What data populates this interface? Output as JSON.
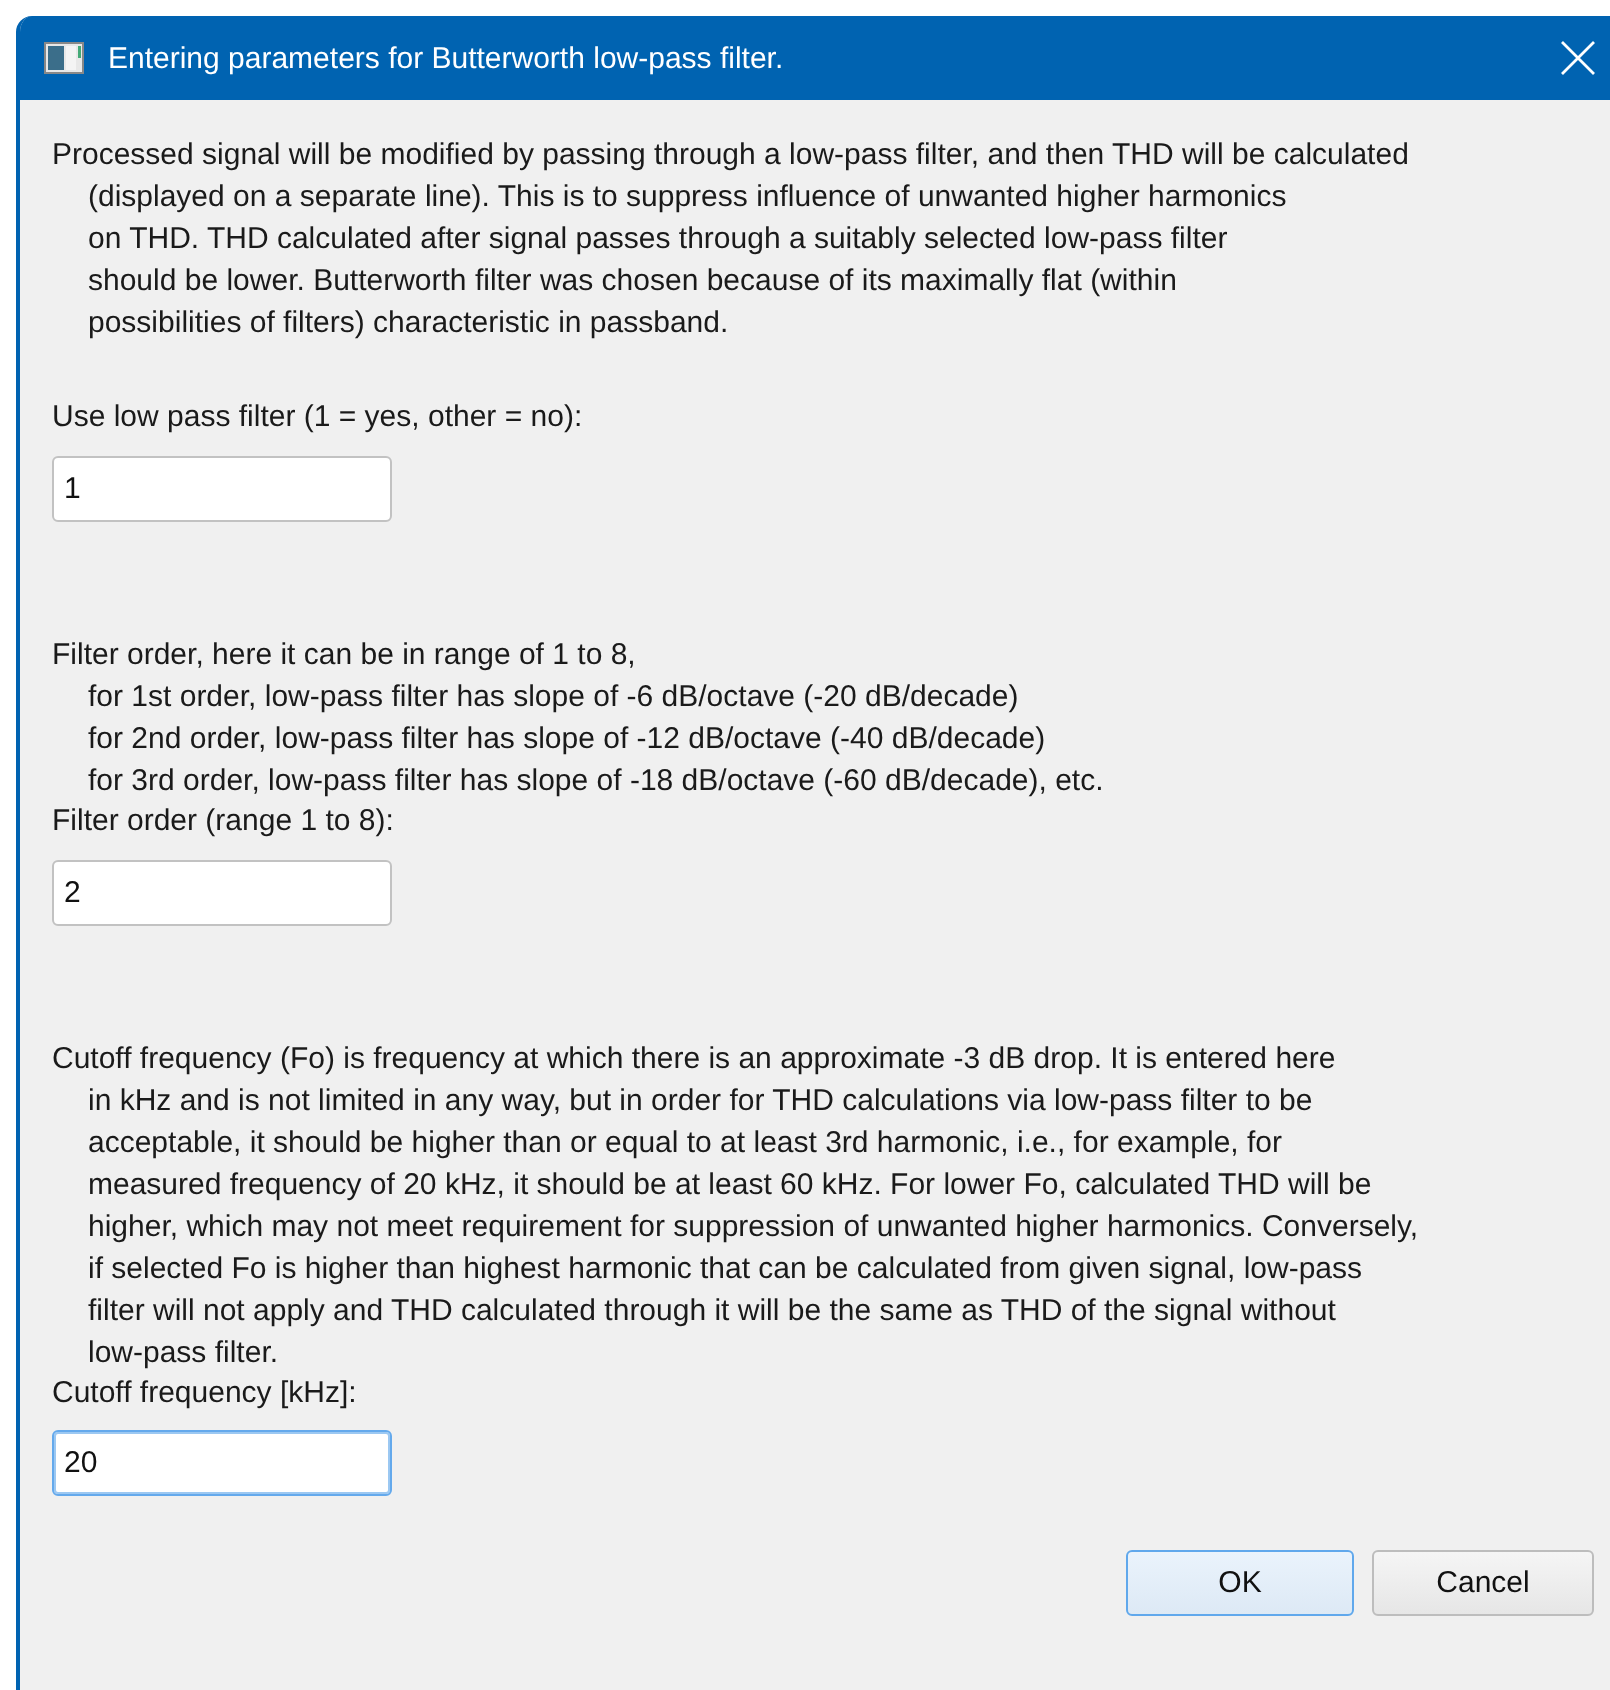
{
  "window": {
    "title": "Entering parameters for Butterworth low-pass filter."
  },
  "sections": [
    {
      "description": [
        "Processed signal will be modified by passing through a low-pass filter, and then THD will be calculated",
        "(displayed on a separate line). This is to suppress influence of unwanted higher harmonics",
        "on THD. THD calculated after signal passes through a suitably selected low-pass filter",
        "should be lower. Butterworth filter was chosen because of its maximally flat (within",
        "possibilities of filters) characteristic in passband."
      ],
      "label": "Use low pass filter (1 = yes, other = no):",
      "field": {
        "value": "1",
        "focused": false
      }
    },
    {
      "description": [
        "Filter order, here it can be in range of 1 to 8,",
        "for 1st order, low-pass filter has slope of -6 dB/octave (-20 dB/decade)",
        "for 2nd order, low-pass filter has slope of -12 dB/octave (-40 dB/decade)",
        "for 3rd order, low-pass filter has slope of -18 dB/octave (-60 dB/decade), etc."
      ],
      "label": "Filter order (range 1 to 8):",
      "field": {
        "value": "2",
        "focused": false
      }
    },
    {
      "description": [
        "Cutoff frequency (Fo) is frequency at which there is an approximate -3 dB drop. It is entered here",
        "in kHz and is not limited in any way, but in order for THD calculations via low-pass filter to be",
        "acceptable, it should be higher than or equal to at least 3rd harmonic, i.e., for example, for",
        "measured frequency of 20 kHz, it should be at least 60 kHz. For lower Fo, calculated THD will be",
        "higher, which may not meet requirement for suppression of unwanted higher harmonics. Conversely,",
        "if selected Fo is higher than highest harmonic that can be calculated from given signal, low-pass",
        "filter will not apply and THD calculated through it will be the same as THD of the signal without",
        "low-pass filter."
      ],
      "label": "Cutoff frequency [kHz]:",
      "field": {
        "value": "20",
        "focused": true
      }
    }
  ],
  "buttons": [
    {
      "label": "OK",
      "default": true
    },
    {
      "label": "Cancel",
      "default": false
    }
  ]
}
